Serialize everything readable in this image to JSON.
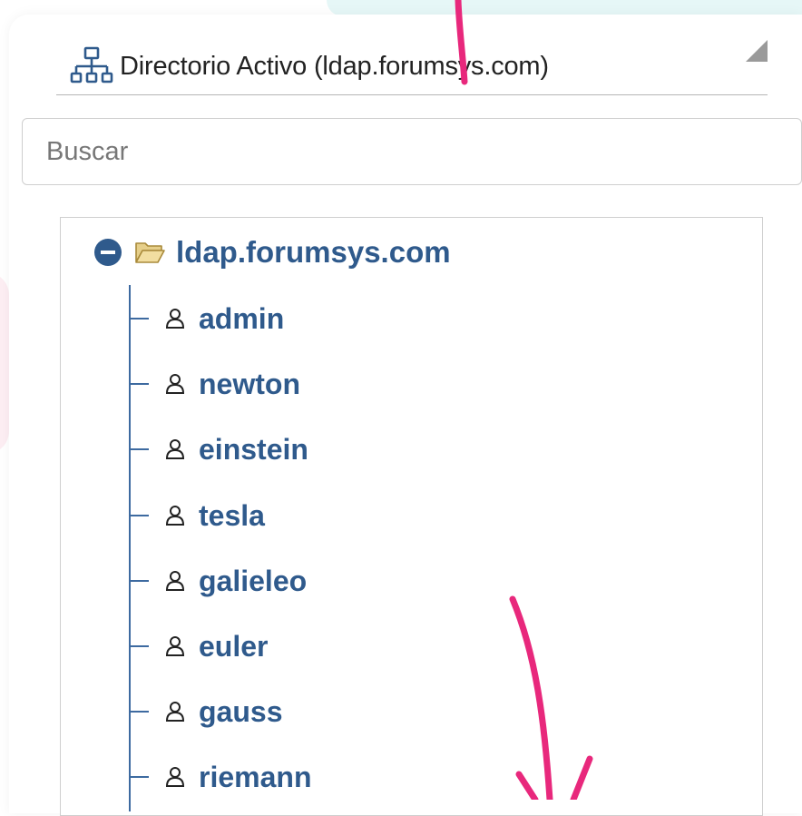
{
  "directory": {
    "icon": "network-tree-icon",
    "label": "Directorio Activo (ldap.forumsys.com)"
  },
  "search": {
    "placeholder": "Buscar",
    "value": ""
  },
  "tree": {
    "root": {
      "label": "ldap.forumsys.com",
      "expanded": true,
      "toggle_icon": "minus-circle-icon",
      "icon": "open-folder-icon"
    },
    "users": [
      {
        "label": "admin"
      },
      {
        "label": "newton"
      },
      {
        "label": "einstein"
      },
      {
        "label": "tesla"
      },
      {
        "label": "galieleo"
      },
      {
        "label": "euler"
      },
      {
        "label": "gauss"
      },
      {
        "label": "riemann"
      }
    ],
    "user_icon": "user-icon"
  },
  "colors": {
    "tree_text": "#2f5a8c",
    "tree_line": "#3d6aa0",
    "folder": "#e6cf8a",
    "annotation_arrow": "#e8287c",
    "top_tint": "#e6f7f7"
  }
}
